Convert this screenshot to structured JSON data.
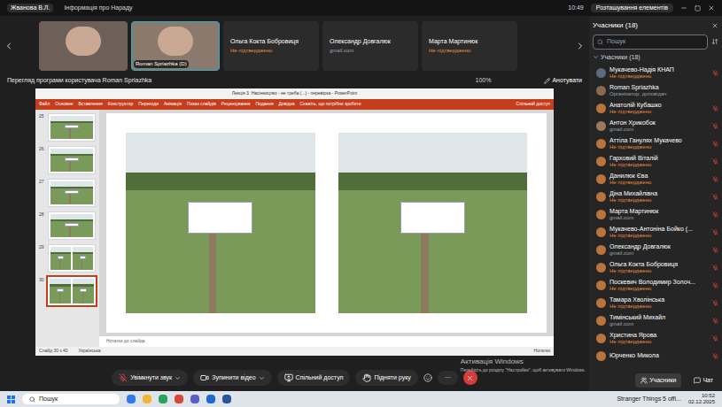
{
  "top_bar": {
    "presenter": "Жванова В.Л.",
    "tab": "Інформація про Нараду",
    "time": "10:49",
    "layout_button": "Розташування елементів"
  },
  "video_strip": {
    "tiles": [
      {
        "kind": "video",
        "label": ""
      },
      {
        "kind": "video",
        "label": "Roman Spriazhka (D)"
      },
      {
        "kind": "name",
        "label": "Ольга Кокта Бобровиця",
        "subtitle": "Не підтверджено",
        "warning": true
      },
      {
        "kind": "name",
        "label": "Олександр Довгалюк",
        "subtitle": "gmail.com",
        "warning": false
      },
      {
        "kind": "name",
        "label": "Марта Мартинюк",
        "subtitle": "Не підтверджено",
        "warning": true
      }
    ]
  },
  "share_bar": {
    "label": "Перегляд програми користувача Roman Spriazhka",
    "zoom": "100%",
    "annotate": "Анотувати"
  },
  "powerpoint": {
    "title": "Лекція 3. Насінництво - не треба (...) - перевірка - PowerPoint",
    "menu": [
      "Файл",
      "Основне",
      "Вставлення",
      "Конструктор",
      "Переходи",
      "Анімація",
      "Показ слайдів",
      "Рецензування",
      "Подання",
      "Довідка",
      "Скажіть, що потрібно зробити"
    ],
    "share": "Спільний доступ",
    "thumbnails": [
      {
        "number": "25",
        "photos": 1,
        "selected": false
      },
      {
        "number": "26",
        "photos": 1,
        "selected": false
      },
      {
        "number": "27",
        "photos": 1,
        "selected": false
      },
      {
        "number": "28",
        "photos": 1,
        "selected": false
      },
      {
        "number": "29",
        "photos": 2,
        "selected": false
      },
      {
        "number": "30",
        "photos": 2,
        "selected": true
      }
    ],
    "notes": "Нотатки до слайда",
    "status": "Слайд 30 з 40",
    "language": "Українська",
    "status_right": "Нотатки"
  },
  "controls": [
    {
      "label": "Увімкнути звук",
      "kind": "mic"
    },
    {
      "label": "Зупинити відео",
      "kind": "video"
    },
    {
      "label": "Спільний доступ",
      "kind": "share"
    },
    {
      "label": "Підняти руку",
      "kind": "hand"
    }
  ],
  "more": "···",
  "side_buttons": [
    {
      "label": "Учасники",
      "selected": true
    },
    {
      "label": "Чат",
      "selected": false
    }
  ],
  "participants_panel": {
    "title": "Учасники (18)",
    "search": "Пошук",
    "group": "Учасники (18)",
    "items": [
      {
        "name": "Мукачево-Надія КНАП",
        "subtitle": "Не підтверджено",
        "warning": true,
        "muted": true,
        "color": "#5b6b7a"
      },
      {
        "name": "Roman Spriazhka",
        "subtitle": "Організатор, доповідач",
        "warning": false,
        "muted": false,
        "color": "#8a6a4e"
      },
      {
        "name": "Анатолій Кубашко",
        "subtitle": "Не підтверджено",
        "warning": true,
        "muted": true,
        "color": "#b8743a"
      },
      {
        "name": "Антон Хрикобок",
        "subtitle": "gmail.com",
        "warning": false,
        "muted": true,
        "color": "#9a7a5a"
      },
      {
        "name": "Аттіла Ганулях Мукачево",
        "subtitle": "Не підтверджено",
        "warning": true,
        "muted": true,
        "color": "#b8743a"
      },
      {
        "name": "Гарховий Віталій",
        "subtitle": "Не підтверджено",
        "warning": true,
        "muted": true,
        "color": "#b8743a"
      },
      {
        "name": "Данилюк Єва",
        "subtitle": "Не підтверджено",
        "warning": true,
        "muted": true,
        "color": "#b8743a"
      },
      {
        "name": "Діна Михайлівна",
        "subtitle": "Не підтверджено",
        "warning": true,
        "muted": true,
        "color": "#b8743a"
      },
      {
        "name": "Марта Мартинюк",
        "subtitle": "gmail.com",
        "warning": false,
        "muted": true,
        "color": "#b8743a"
      },
      {
        "name": "Мукачево-Антоніна Бойко (...",
        "subtitle": "Не підтверджено",
        "warning": true,
        "muted": true,
        "color": "#b8743a"
      },
      {
        "name": "Олександр Довгалюк",
        "subtitle": "gmail.com",
        "warning": false,
        "muted": true,
        "color": "#b8743a"
      },
      {
        "name": "Ольга Кокта Бобровиця",
        "subtitle": "Не підтверджено",
        "warning": true,
        "muted": true,
        "color": "#b8743a"
      },
      {
        "name": "Поскевич Володимир Золоч...",
        "subtitle": "Не підтверджено",
        "warning": true,
        "muted": true,
        "color": "#b8743a"
      },
      {
        "name": "Тамара Хволінська",
        "subtitle": "Не підтверджено",
        "warning": true,
        "muted": true,
        "color": "#b8743a"
      },
      {
        "name": "Тимінський Михайл",
        "subtitle": "gmail.com",
        "warning": false,
        "muted": true,
        "color": "#b8743a"
      },
      {
        "name": "Христина Ярова",
        "subtitle": "Не підтверджено",
        "warning": true,
        "muted": true,
        "color": "#b8743a"
      },
      {
        "name": "Юрченко Микола",
        "subtitle": "",
        "warning": false,
        "muted": true,
        "color": "#b8743a"
      }
    ]
  },
  "watermark": {
    "title": "Активація Windows",
    "text": "Перейдіть до розділу \"Настройки\", щоб активувати Windows."
  },
  "taskbar": {
    "search": "Пошук",
    "app": "Stranger Things 5 offi...",
    "time": "10:52",
    "date": "02.12.2025"
  }
}
